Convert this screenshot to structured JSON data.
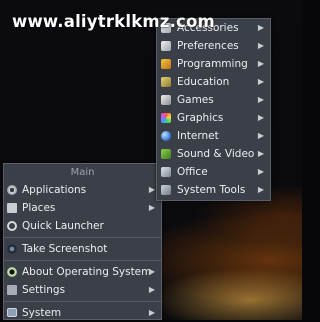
{
  "watermark": "www.aliytrklkmz.com",
  "main_menu": {
    "title": "Main",
    "applications": "Applications",
    "places": "Places",
    "quick_launcher": "Quick Launcher",
    "take_screenshot": "Take Screenshot",
    "about_os": "About Operating System",
    "settings": "Settings",
    "system": "System"
  },
  "submenu_arrow": "▶",
  "applications_submenu": {
    "accessories": "Accessories",
    "preferences": "Preferences",
    "programming": "Programming",
    "education": "Education",
    "games": "Games",
    "graphics": "Graphics",
    "internet": "Internet",
    "sound_video": "Sound & Video",
    "office": "Office",
    "system_tools": "System Tools"
  },
  "icons": {
    "applications": "gear-icon",
    "places": "folder-icon",
    "quick_launcher": "magnifier-icon",
    "take_screenshot": "camera-icon",
    "about_os": "os-logo-icon",
    "settings": "settings-icon",
    "system": "monitor-icon"
  }
}
